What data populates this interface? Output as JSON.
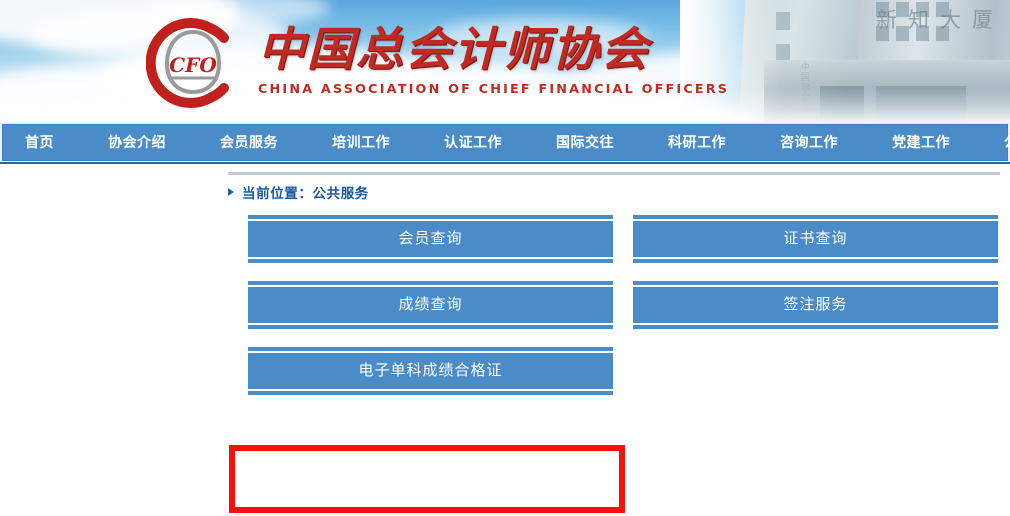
{
  "site": {
    "logo_text": "CFO",
    "title_cn": "中国总会计师协会",
    "title_en": "CHINA ASSOCIATION OF CHIEF FINANCIAL OFFICERS",
    "banner_building_sign": "新知大厦",
    "banner_building_vsign": "中国总会计师协会"
  },
  "nav": {
    "items": [
      {
        "label": "首页",
        "name": "nav-item-home"
      },
      {
        "label": "协会介绍",
        "name": "nav-item-about"
      },
      {
        "label": "会员服务",
        "name": "nav-item-member-service"
      },
      {
        "label": "培训工作",
        "name": "nav-item-training"
      },
      {
        "label": "认证工作",
        "name": "nav-item-certification"
      },
      {
        "label": "国际交往",
        "name": "nav-item-international"
      },
      {
        "label": "科研工作",
        "name": "nav-item-research"
      },
      {
        "label": "咨询工作",
        "name": "nav-item-consulting"
      },
      {
        "label": "党建工作",
        "name": "nav-item-party-building"
      },
      {
        "label": "公共服务",
        "name": "nav-item-public-service"
      }
    ]
  },
  "breadcrumb": {
    "prefix": "当前位置：",
    "current": "公共服务",
    "full": "当前位置：公共服务"
  },
  "service_buttons": [
    {
      "label": "会员查询",
      "name": "service-button-member-query",
      "highlighted": false
    },
    {
      "label": "证书查询",
      "name": "service-button-certificate-query",
      "highlighted": false
    },
    {
      "label": "成绩查询",
      "name": "service-button-score-query",
      "highlighted": true
    },
    {
      "label": "签注服务",
      "name": "service-button-endorsement",
      "highlighted": false
    },
    {
      "label": "电子单科成绩合格证",
      "name": "service-button-e-subject-certificate",
      "highlighted": false
    }
  ],
  "annotation": {
    "target_label": "成绩查询",
    "color": "#fb0f08",
    "shape": "rectangle"
  },
  "colors": {
    "nav_blue": "#4a8cc8",
    "button_blue": "#4a8cc8",
    "brand_red": "#c02a22",
    "crumb_blue": "#1a5aa4",
    "highlight_red": "#fb0f08",
    "rule_gray": "#c3ccd4"
  }
}
